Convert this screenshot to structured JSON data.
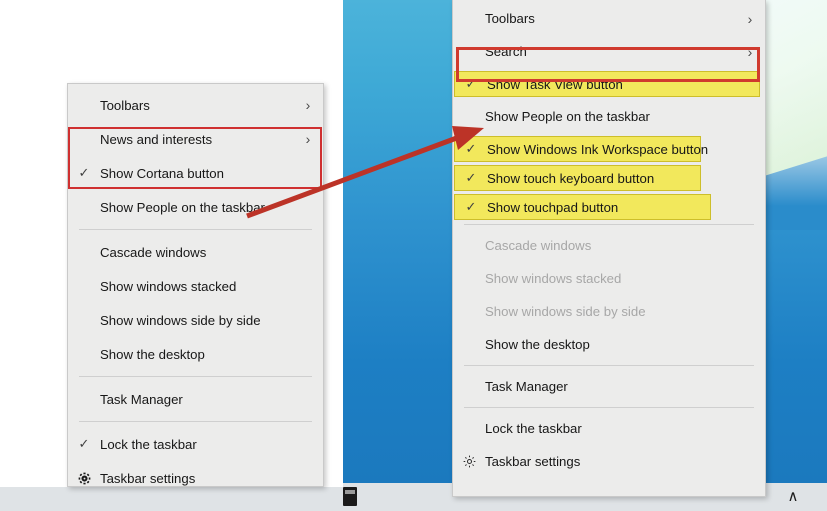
{
  "scene": {
    "description": "Windows 10 taskbar right-click context menu comparison",
    "colors": {
      "menu_background": "#ececeb",
      "highlight_yellow": "#f2e85c",
      "annotation_red": "#cf3030",
      "desktop_blue": "#2f93cf",
      "taskbar_gray": "#dfe3e6",
      "disabled_text": "#a7a7a7"
    }
  },
  "left_menu": {
    "name": "taskbar-context-menu-new",
    "items": [
      {
        "label": "Toolbars",
        "checked": false,
        "submenu": true,
        "disabled": false,
        "highlight": false,
        "icon": ""
      },
      {
        "label": "News and interests",
        "checked": false,
        "submenu": true,
        "disabled": false,
        "highlight": false,
        "icon": ""
      },
      {
        "label": "Show Cortana button",
        "checked": true,
        "submenu": false,
        "disabled": false,
        "highlight": false,
        "icon": ""
      },
      {
        "label": "Show People on the taskbar",
        "checked": false,
        "submenu": false,
        "disabled": false,
        "highlight": false,
        "icon": ""
      },
      {
        "label": "Cascade windows",
        "checked": false,
        "submenu": false,
        "disabled": false,
        "highlight": false,
        "icon": ""
      },
      {
        "label": "Show windows stacked",
        "checked": false,
        "submenu": false,
        "disabled": false,
        "highlight": false,
        "icon": ""
      },
      {
        "label": "Show windows side by side",
        "checked": false,
        "submenu": false,
        "disabled": false,
        "highlight": false,
        "icon": ""
      },
      {
        "label": "Show the desktop",
        "checked": false,
        "submenu": false,
        "disabled": false,
        "highlight": false,
        "icon": ""
      },
      {
        "label": "Task Manager",
        "checked": false,
        "submenu": false,
        "disabled": false,
        "highlight": false,
        "icon": ""
      },
      {
        "label": "Lock the taskbar",
        "checked": true,
        "submenu": false,
        "disabled": false,
        "highlight": false,
        "icon": ""
      },
      {
        "label": "Taskbar settings",
        "checked": false,
        "submenu": false,
        "disabled": false,
        "highlight": false,
        "icon": "gear-icon"
      }
    ],
    "annotation": {
      "type": "red-rectangle",
      "covers": [
        "News and interests",
        "Show Cortana button"
      ]
    }
  },
  "right_menu": {
    "name": "taskbar-context-menu-old",
    "items": [
      {
        "label": "Toolbars",
        "checked": false,
        "submenu": true,
        "disabled": false,
        "highlight": false,
        "icon": ""
      },
      {
        "label": "Search",
        "checked": false,
        "submenu": true,
        "disabled": false,
        "highlight": false,
        "icon": ""
      },
      {
        "label": "Show Task View button",
        "checked": true,
        "submenu": false,
        "disabled": false,
        "highlight": true,
        "icon": ""
      },
      {
        "label": "Show People on the taskbar",
        "checked": false,
        "submenu": false,
        "disabled": false,
        "highlight": false,
        "icon": ""
      },
      {
        "label": "Show Windows Ink Workspace button",
        "checked": true,
        "submenu": false,
        "disabled": false,
        "highlight": true,
        "icon": ""
      },
      {
        "label": "Show touch keyboard button",
        "checked": true,
        "submenu": false,
        "disabled": false,
        "highlight": true,
        "icon": ""
      },
      {
        "label": "Show touchpad button",
        "checked": true,
        "submenu": false,
        "disabled": false,
        "highlight": true,
        "icon": ""
      },
      {
        "label": "Cascade windows",
        "checked": false,
        "submenu": false,
        "disabled": true,
        "highlight": false,
        "icon": ""
      },
      {
        "label": "Show windows stacked",
        "checked": false,
        "submenu": false,
        "disabled": true,
        "highlight": false,
        "icon": ""
      },
      {
        "label": "Show windows side by side",
        "checked": false,
        "submenu": false,
        "disabled": true,
        "highlight": false,
        "icon": ""
      },
      {
        "label": "Show the desktop",
        "checked": false,
        "submenu": false,
        "disabled": false,
        "highlight": false,
        "icon": ""
      },
      {
        "label": "Task Manager",
        "checked": false,
        "submenu": false,
        "disabled": false,
        "highlight": false,
        "icon": ""
      },
      {
        "label": "Lock the taskbar",
        "checked": false,
        "submenu": false,
        "disabled": false,
        "highlight": false,
        "icon": ""
      },
      {
        "label": "Taskbar settings",
        "checked": false,
        "submenu": false,
        "disabled": false,
        "highlight": false,
        "icon": "gear-icon"
      }
    ],
    "annotation": {
      "type": "red-rectangle",
      "covers": [
        "Search"
      ]
    }
  },
  "annotations": {
    "arrow": {
      "name": "pointer-arrow",
      "from_label": "Show People on the taskbar (left menu)",
      "to_label": "Show People on the taskbar (right menu)",
      "color": "#bc3327"
    }
  },
  "taskbar": {
    "tray_chevron": "∧",
    "app_icon": "app-icon"
  },
  "glyphs": {
    "check": "✓",
    "chevron_right": "›"
  }
}
